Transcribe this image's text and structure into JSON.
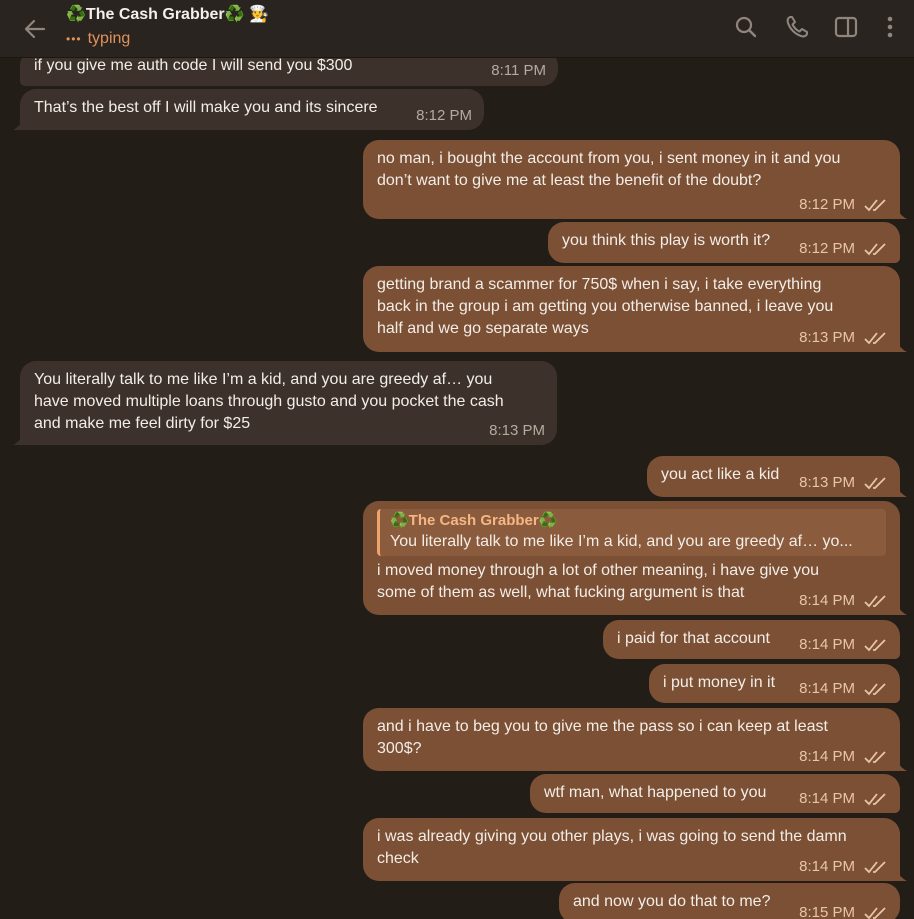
{
  "header": {
    "title": "♻️The Cash Grabber♻️ 🧑‍🍳",
    "status_dots": "•••",
    "status": "typing"
  },
  "messages": [
    {
      "text": "if you give me auth code I will send you $300",
      "time": "8:11 PM"
    },
    {
      "text": "That’s the best off I will make you and its sincere",
      "time": "8:12 PM"
    },
    {
      "text": "no man, i bought the account from you, i sent money in it and you\ndon’t want to give me at least the benefit of the doubt?",
      "time": "8:12 PM"
    },
    {
      "text": "you think this play is worth it?",
      "time": "8:12 PM"
    },
    {
      "text": "getting brand a scammer for 750$ when i say, i take everything\nback in the group i am getting you otherwise banned, i leave you\nhalf and we go separate ways",
      "time": "8:13 PM"
    },
    {
      "text": "You literally talk to me like I’m a kid, and you are greedy af… you\nhave moved multiple loans through gusto and you pocket the cash\nand make me feel dirty for $25",
      "time": "8:13 PM"
    },
    {
      "text": "you act like a kid",
      "time": "8:13 PM"
    },
    {
      "reply_name": "♻️The Cash Grabber♻️",
      "reply_text": "You literally talk to me like I’m a kid, and you are greedy af… yo...",
      "text": "i moved money through a lot of other meaning, i have give you\nsome of them as well, what fucking argument is that",
      "time": "8:14 PM"
    },
    {
      "text": "i paid for that account",
      "time": "8:14 PM"
    },
    {
      "text": "i put money in it",
      "time": "8:14 PM"
    },
    {
      "text": "and i have to beg you to give me the pass so i can keep at least\n300$?",
      "time": "8:14 PM"
    },
    {
      "text": "wtf man, what happened to you",
      "time": "8:14 PM"
    },
    {
      "text": "i was already giving you other plays, i was going to send the damn\ncheck",
      "time": "8:14 PM"
    },
    {
      "text": "and now you do that to me?",
      "time": "8:15 PM"
    }
  ],
  "colors": {
    "background": "#231d18",
    "incoming_bubble": "#3c322b",
    "outgoing_bubble": "#7b5034",
    "accent": "#e0915a"
  }
}
